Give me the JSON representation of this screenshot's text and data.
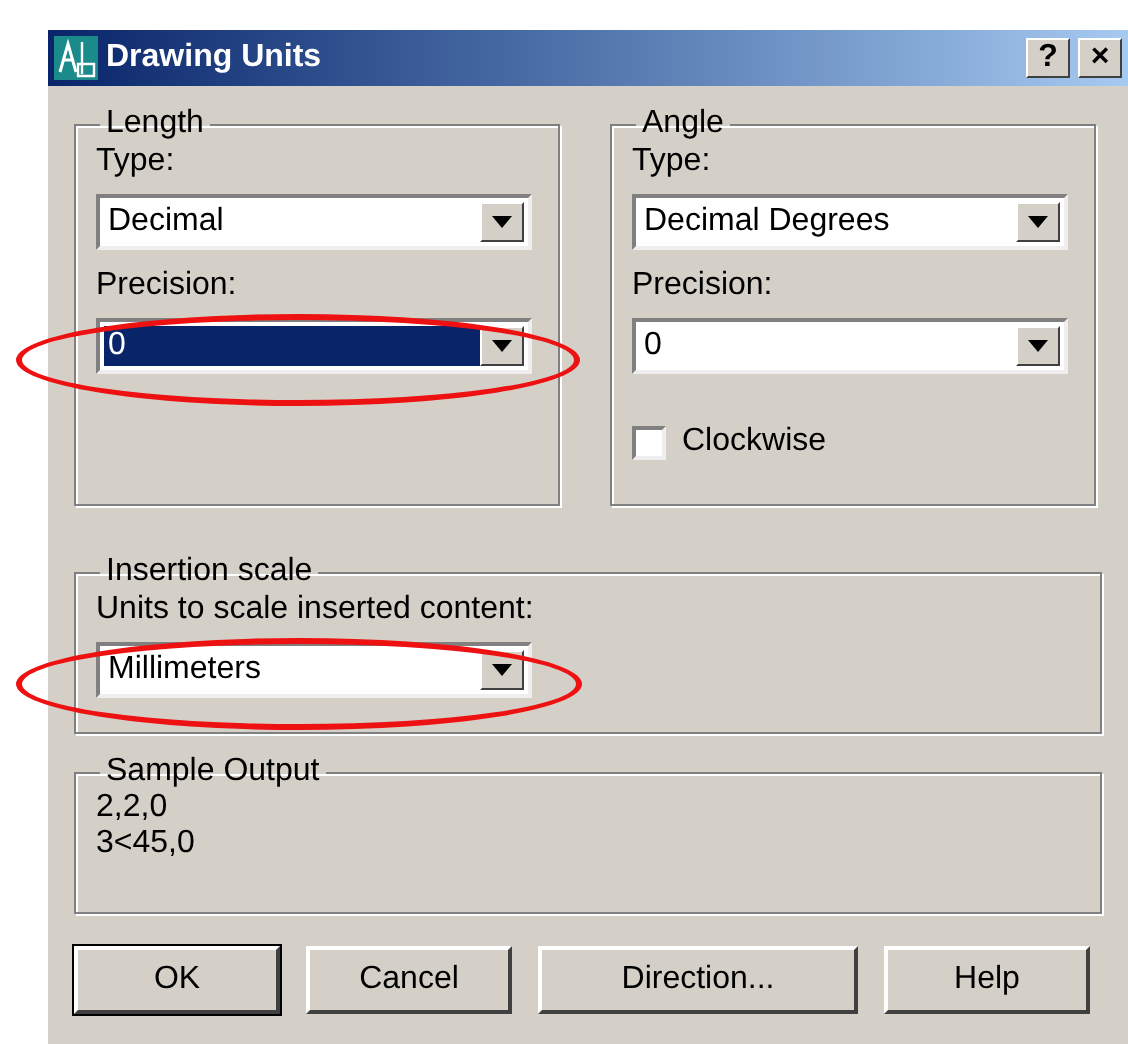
{
  "window": {
    "title": "Drawing Units",
    "title_buttons": [
      "?",
      "×"
    ]
  },
  "length": {
    "title": "Length",
    "fields": [
      {
        "label": "Type:",
        "value": "Decimal",
        "focused": false,
        "circled": false
      },
      {
        "label": "Precision:",
        "value": "0",
        "focused": true,
        "circled": true
      }
    ]
  },
  "angle": {
    "title": "Angle",
    "fields": [
      {
        "label": "Type:",
        "value": "Decimal Degrees",
        "focused": false,
        "circled": false
      },
      {
        "label": "Precision:",
        "value": "0",
        "focused": false,
        "circled": false
      }
    ],
    "clockwise": {
      "label": "Clockwise",
      "checked": false
    }
  },
  "insertion_scale": {
    "title": "Insertion scale",
    "fields": [
      {
        "label": "Units to scale inserted content:",
        "value": "Millimeters",
        "focused": false,
        "circled": true
      }
    ]
  },
  "sample_output": {
    "title": "Sample Output",
    "lines": [
      "2,2,0",
      "3<45,0"
    ]
  },
  "buttons": [
    {
      "label": "OK",
      "default": true
    },
    {
      "label": "Cancel",
      "default": false
    },
    {
      "label": "Direction...",
      "default": false
    },
    {
      "label": "Help",
      "default": false
    }
  ]
}
